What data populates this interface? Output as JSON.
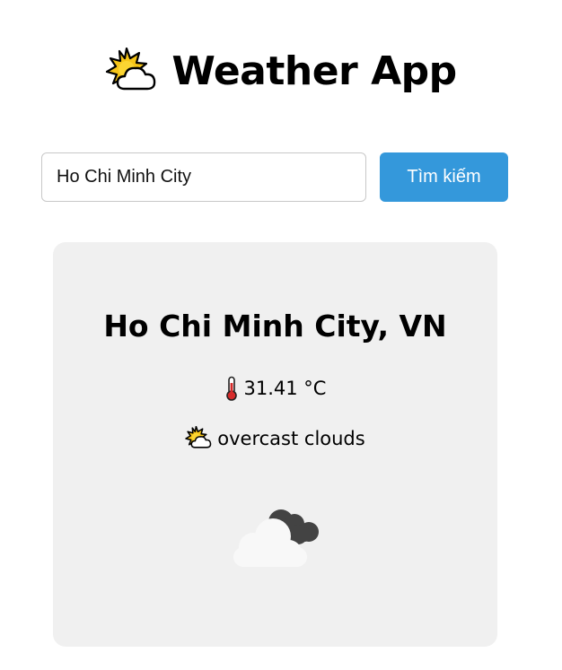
{
  "header": {
    "icon": "sun-behind-cloud-icon",
    "title": "Weather App"
  },
  "search": {
    "value": "Ho Chi Minh City",
    "button_label": "Tìm kiếm"
  },
  "weather": {
    "location": "Ho Chi Minh City, VN",
    "temperature_icon": "thermometer-icon",
    "temperature": "31.41 °C",
    "description_icon": "sun-behind-cloud-icon",
    "description": "overcast clouds",
    "condition_image": "overcast-clouds-icon"
  },
  "colors": {
    "accent": "#3498db",
    "card_background": "#f0f0f0"
  }
}
